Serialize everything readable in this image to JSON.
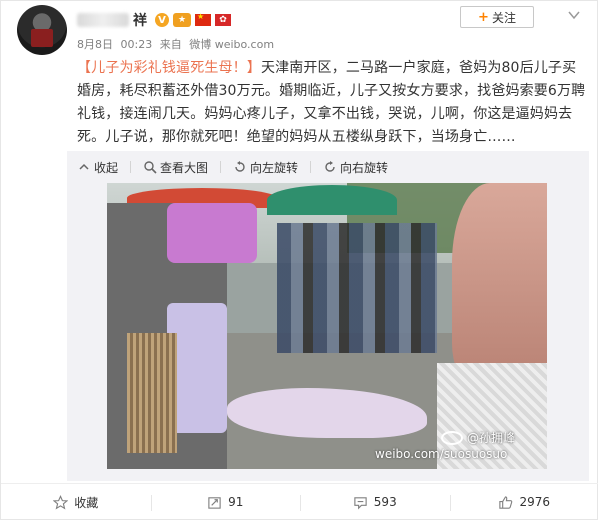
{
  "account": {
    "name_suffix": "祥",
    "badges": [
      "vip-badge",
      "crown-badge",
      "china-flag-badge",
      "hong-kong-flag-badge"
    ],
    "follow_label": "关注"
  },
  "meta": {
    "date": "8月8日",
    "time": "00:23",
    "source_prefix": "来自",
    "source": "微博 weibo.com"
  },
  "post": {
    "headline": "【儿子为彩礼钱逼死生母！】",
    "body": "天津南开区，二马路一户家庭，爸妈为80后儿子买婚房，耗尽积蓄还外借30万元。婚期临近，儿子又按女方要求，找爸妈索要6万聘礼钱，接连闹几天。妈妈心疼儿子，又拿不出钱，哭说，儿啊，你这是逼妈妈去死。儿子说，那你就死吧！绝望的妈妈从五楼纵身跃下，当场身亡……"
  },
  "image_tools": {
    "collapse": "收起",
    "view_large": "查看大图",
    "rotate_left": "向左旋转",
    "rotate_right": "向右旋转"
  },
  "watermark": {
    "handle": "@孙拥峰",
    "url": "weibo.com/suosuosuo"
  },
  "footer": {
    "favorite": "收藏",
    "repost_count": "91",
    "comment_count": "593",
    "like_count": "2976"
  },
  "colors": {
    "accent_link": "#eb7350",
    "follow_plus": "#ff8200",
    "expanded_bg": "#f2f2f5"
  }
}
